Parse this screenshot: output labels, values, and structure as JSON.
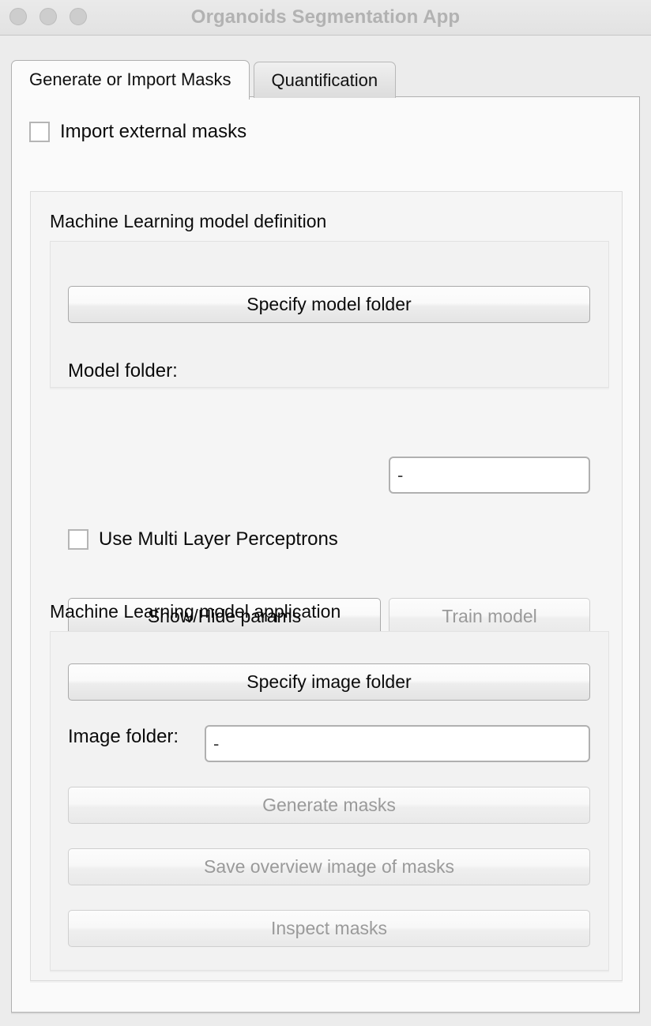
{
  "window": {
    "title": "Organoids Segmentation App",
    "traffic_lights": [
      "close-button",
      "minimize-button",
      "maximize-button"
    ]
  },
  "tabs": [
    {
      "label": "Generate or Import Masks",
      "active": true
    },
    {
      "label": "Quantification",
      "active": false
    }
  ],
  "import_masks": {
    "label": "Import external masks",
    "checked": false
  },
  "model_definition": {
    "title": "Machine Learning model definition",
    "specify_model_folder_button": "Specify model folder",
    "model_folder_label": "Model folder:",
    "model_folder_value": "-",
    "mlp_checkbox_label": "Use Multi Layer Perceptrons",
    "mlp_checked": false,
    "show_hide_params_button": "Show/Hide params",
    "train_model_button": "Train model",
    "train_model_enabled": false
  },
  "model_application": {
    "title": "Machine Learning model application",
    "specify_image_folder_button": "Specify image folder",
    "image_folder_label": "Image folder:",
    "image_folder_value": "-",
    "generate_masks_button": "Generate masks",
    "save_overview_button": "Save overview image of masks",
    "inspect_masks_button": "Inspect masks",
    "generate_masks_enabled": false,
    "save_overview_enabled": false,
    "inspect_masks_enabled": false
  },
  "colors": {
    "window_background": "#ececec",
    "panel_background": "#fafafa",
    "title_text": "#b2b2b2",
    "body_text": "#0b0b0b",
    "disabled_text": "#9a9a9a",
    "border": "#b0b0b0"
  }
}
